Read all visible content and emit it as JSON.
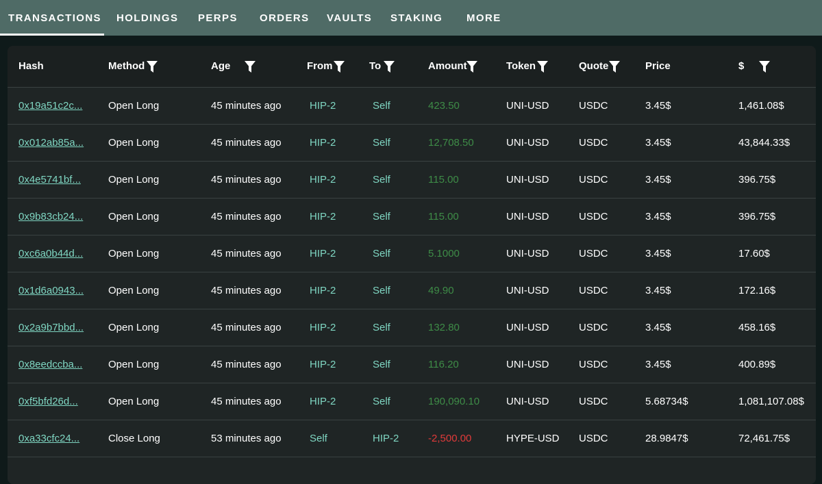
{
  "tabs": [
    {
      "label": "TRANSACTIONS"
    },
    {
      "label": "HOLDINGS"
    },
    {
      "label": "PERPS"
    },
    {
      "label": "ORDERS"
    },
    {
      "label": "VAULTS"
    },
    {
      "label": "STAKING"
    },
    {
      "label": "MORE"
    }
  ],
  "active_tab": "TRANSACTIONS",
  "columns": {
    "hash": "Hash",
    "method": "Method",
    "age": "Age",
    "from": "From",
    "to": "To",
    "amount": "Amount",
    "token": "Token",
    "quote": "Quote",
    "price": "Price",
    "usd": "$"
  },
  "colors": {
    "topbar": "#4f6b66",
    "link": "#7fd6c2",
    "positive": "#3e8c47",
    "negative": "#e03a3a"
  },
  "icons": {
    "filter": "filter-icon"
  },
  "rows": [
    {
      "hash": "0x19a51c2c...",
      "method": "Open Long",
      "age": "45 minutes ago",
      "from": "HIP-2",
      "to": "Self",
      "amount": "423.50",
      "sign": "pos",
      "token": "UNI-USD",
      "quote": "USDC",
      "price": "3.45$",
      "usd": "1,461.08$"
    },
    {
      "hash": "0x012ab85a...",
      "method": "Open Long",
      "age": "45 minutes ago",
      "from": "HIP-2",
      "to": "Self",
      "amount": "12,708.50",
      "sign": "pos",
      "token": "UNI-USD",
      "quote": "USDC",
      "price": "3.45$",
      "usd": "43,844.33$"
    },
    {
      "hash": "0x4e5741bf...",
      "method": "Open Long",
      "age": "45 minutes ago",
      "from": "HIP-2",
      "to": "Self",
      "amount": "115.00",
      "sign": "pos",
      "token": "UNI-USD",
      "quote": "USDC",
      "price": "3.45$",
      "usd": "396.75$"
    },
    {
      "hash": "0x9b83cb24...",
      "method": "Open Long",
      "age": "45 minutes ago",
      "from": "HIP-2",
      "to": "Self",
      "amount": "115.00",
      "sign": "pos",
      "token": "UNI-USD",
      "quote": "USDC",
      "price": "3.45$",
      "usd": "396.75$"
    },
    {
      "hash": "0xc6a0b44d...",
      "method": "Open Long",
      "age": "45 minutes ago",
      "from": "HIP-2",
      "to": "Self",
      "amount": "5.1000",
      "sign": "pos",
      "token": "UNI-USD",
      "quote": "USDC",
      "price": "3.45$",
      "usd": "17.60$"
    },
    {
      "hash": "0x1d6a0943...",
      "method": "Open Long",
      "age": "45 minutes ago",
      "from": "HIP-2",
      "to": "Self",
      "amount": "49.90",
      "sign": "pos",
      "token": "UNI-USD",
      "quote": "USDC",
      "price": "3.45$",
      "usd": "172.16$"
    },
    {
      "hash": "0x2a9b7bbd...",
      "method": "Open Long",
      "age": "45 minutes ago",
      "from": "HIP-2",
      "to": "Self",
      "amount": "132.80",
      "sign": "pos",
      "token": "UNI-USD",
      "quote": "USDC",
      "price": "3.45$",
      "usd": "458.16$"
    },
    {
      "hash": "0x8eedccba...",
      "method": "Open Long",
      "age": "45 minutes ago",
      "from": "HIP-2",
      "to": "Self",
      "amount": "116.20",
      "sign": "pos",
      "token": "UNI-USD",
      "quote": "USDC",
      "price": "3.45$",
      "usd": "400.89$"
    },
    {
      "hash": "0xf5bfd26d...",
      "method": "Open Long",
      "age": "45 minutes ago",
      "from": "HIP-2",
      "to": "Self",
      "amount": "190,090.10",
      "sign": "pos",
      "token": "UNI-USD",
      "quote": "USDC",
      "price": "5.68734$",
      "usd": "1,081,107.08$"
    },
    {
      "hash": "0xa33cfc24...",
      "method": "Close Long",
      "age": "53 minutes ago",
      "from": "Self",
      "to": "HIP-2",
      "amount": "-2,500.00",
      "sign": "neg",
      "token": "HYPE-USD",
      "quote": "USDC",
      "price": "28.9847$",
      "usd": "72,461.75$"
    }
  ]
}
